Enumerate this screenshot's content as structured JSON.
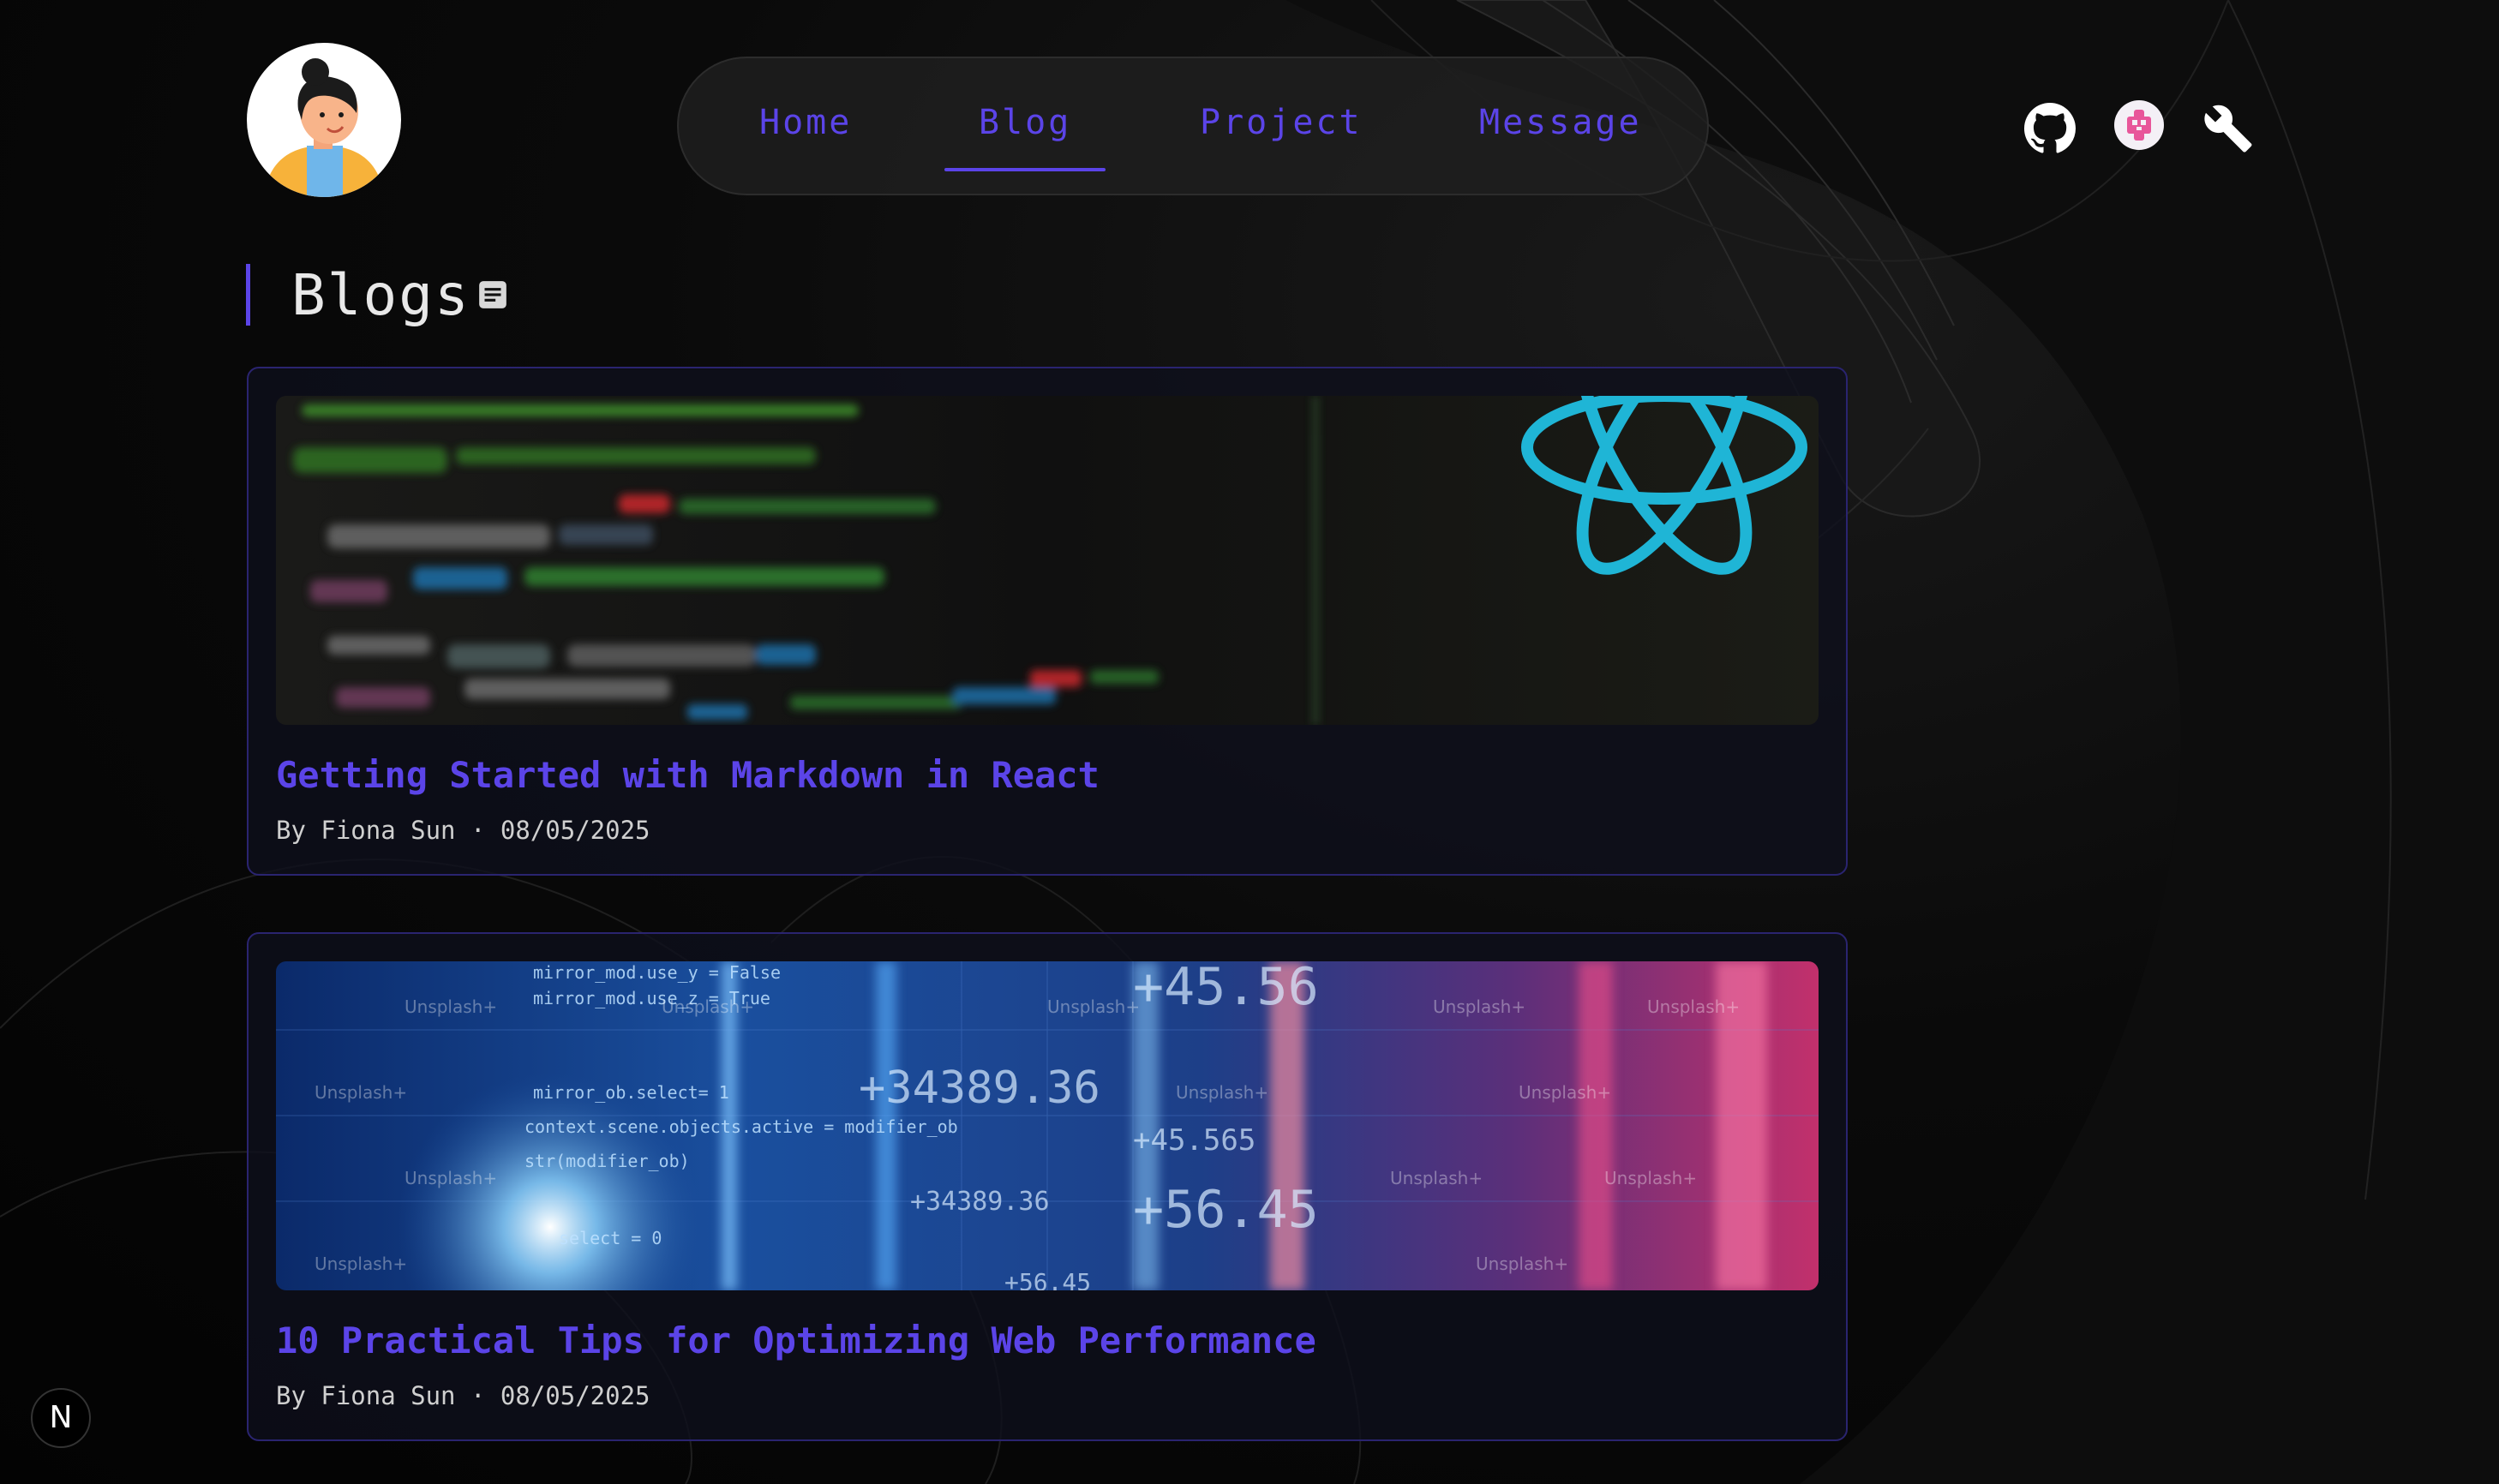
{
  "nav": {
    "items": [
      {
        "label": "Home"
      },
      {
        "label": "Blog"
      },
      {
        "label": "Project"
      },
      {
        "label": "Message"
      }
    ],
    "active": "Blog"
  },
  "page": {
    "heading": "Blogs"
  },
  "posts": [
    {
      "title": "Getting Started with Markdown in React",
      "meta": "By Fiona Sun · 08/05/2025"
    },
    {
      "title": "10 Practical Tips for Optimizing Web Performance",
      "meta": "By Fiona Sun · 08/05/2025"
    }
  ],
  "watermark": "Unsplash+",
  "dev_badge": "N",
  "icons": [
    "github-icon",
    "app-logo-icon",
    "wrench-icon",
    "document-icon"
  ],
  "colors": {
    "accent": "#5b44e8",
    "background": "#050505"
  }
}
